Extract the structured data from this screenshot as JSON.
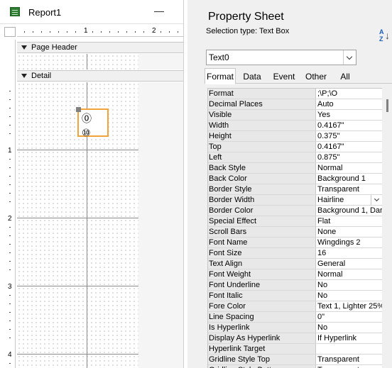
{
  "report": {
    "title": "Report1",
    "ruler_numbers": [
      "1",
      "2"
    ],
    "vruler_numbers": [
      "1",
      "2",
      "3",
      "4"
    ],
    "bands": {
      "page_header": "Page Header",
      "detail": "Detail"
    },
    "textbox_glyphs": "⓪\n⑩"
  },
  "sheet": {
    "title": "Property Sheet",
    "selection_type": "Selection type:  Text Box",
    "object_dropdown_value": "Text0",
    "tabs": [
      "Format",
      "Data",
      "Event",
      "Other",
      "All"
    ],
    "active_tab": "Format",
    "properties": [
      {
        "name": "Format",
        "value": ";\\P;\\O"
      },
      {
        "name": "Decimal Places",
        "value": "Auto"
      },
      {
        "name": "Visible",
        "value": "Yes"
      },
      {
        "name": "Width",
        "value": "0.4167\""
      },
      {
        "name": "Height",
        "value": "0.375\""
      },
      {
        "name": "Top",
        "value": "0.4167\""
      },
      {
        "name": "Left",
        "value": "0.875\""
      },
      {
        "name": "Back Style",
        "value": "Normal"
      },
      {
        "name": "Back Color",
        "value": "Background 1"
      },
      {
        "name": "Border Style",
        "value": "Transparent"
      },
      {
        "name": "Border Width",
        "value": "Hairline"
      },
      {
        "name": "Border Color",
        "value": "Background 1, Dar"
      },
      {
        "name": "Special Effect",
        "value": "Flat"
      },
      {
        "name": "Scroll Bars",
        "value": "None"
      },
      {
        "name": "Font Name",
        "value": "Wingdings 2"
      },
      {
        "name": "Font Size",
        "value": "16"
      },
      {
        "name": "Text Align",
        "value": "General"
      },
      {
        "name": "Font Weight",
        "value": "Normal"
      },
      {
        "name": "Font Underline",
        "value": "No"
      },
      {
        "name": "Font Italic",
        "value": "No"
      },
      {
        "name": "Fore Color",
        "value": "Text 1, Lighter 25%"
      },
      {
        "name": "Line Spacing",
        "value": "0\""
      },
      {
        "name": "Is Hyperlink",
        "value": "No"
      },
      {
        "name": "Display As Hyperlink",
        "value": "If Hyperlink"
      },
      {
        "name": "Hyperlink Target",
        "value": ""
      },
      {
        "name": "Gridline Style Top",
        "value": "Transparent"
      },
      {
        "name": "Gridline Style Bottom",
        "value": "Transparent"
      }
    ]
  },
  "colors": {
    "selection_border": "#f0a33a",
    "grid_header": "#e8e8e8",
    "report_icon": "#2e7d32"
  }
}
